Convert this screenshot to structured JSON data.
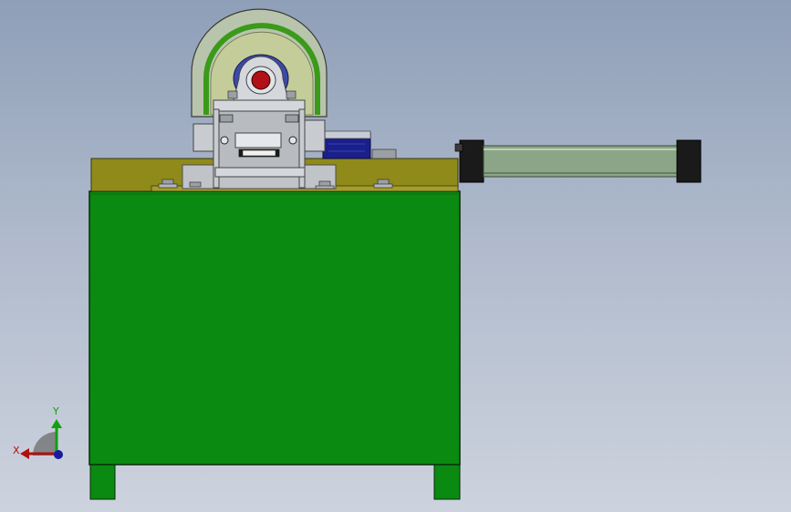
{
  "viewport": {
    "view": "front",
    "background_top": "#8f9fb8",
    "background_bottom": "#cdd3de"
  },
  "model": {
    "cabinet_color": "#0a8a10",
    "tabletop_color": "#8f8a1a",
    "cylinder_color": "#8aa686",
    "motor_color": "#1a1f8a",
    "guard_color": "#b9c4ad",
    "guard_ring_color": "#3a9a1a",
    "steel_color": "#c8ccd0"
  },
  "triad": {
    "x_label": "X",
    "y_label": "Y",
    "x_color": "#b01010",
    "y_color": "#10a010",
    "z_color": "#1a1aa0"
  }
}
